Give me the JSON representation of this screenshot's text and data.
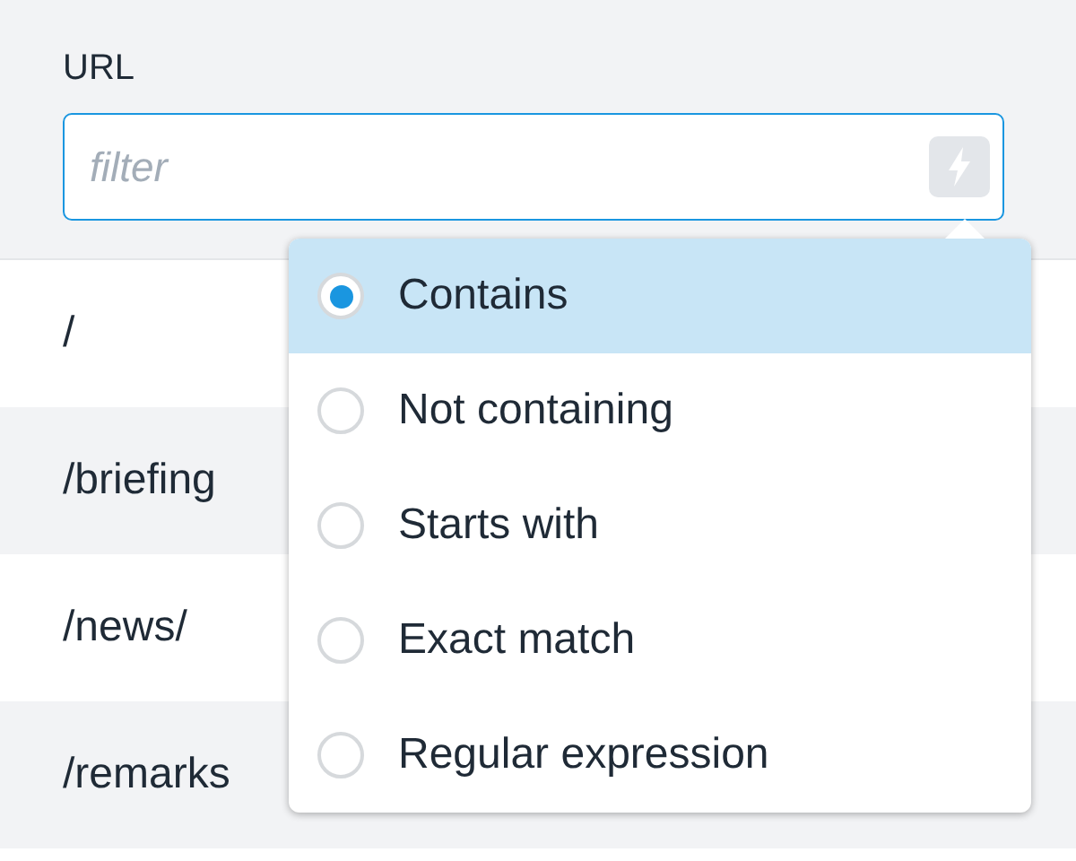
{
  "filter": {
    "label": "URL",
    "placeholder": "filter"
  },
  "rows": [
    {
      "url": "/"
    },
    {
      "url": "/briefing"
    },
    {
      "url": "/news/"
    },
    {
      "url": "/remarks"
    }
  ],
  "match_menu": {
    "options": [
      {
        "label": "Contains",
        "selected": true
      },
      {
        "label": "Not containing",
        "selected": false
      },
      {
        "label": "Starts with",
        "selected": false
      },
      {
        "label": "Exact match",
        "selected": false
      },
      {
        "label": "Regular expression",
        "selected": false
      }
    ]
  }
}
